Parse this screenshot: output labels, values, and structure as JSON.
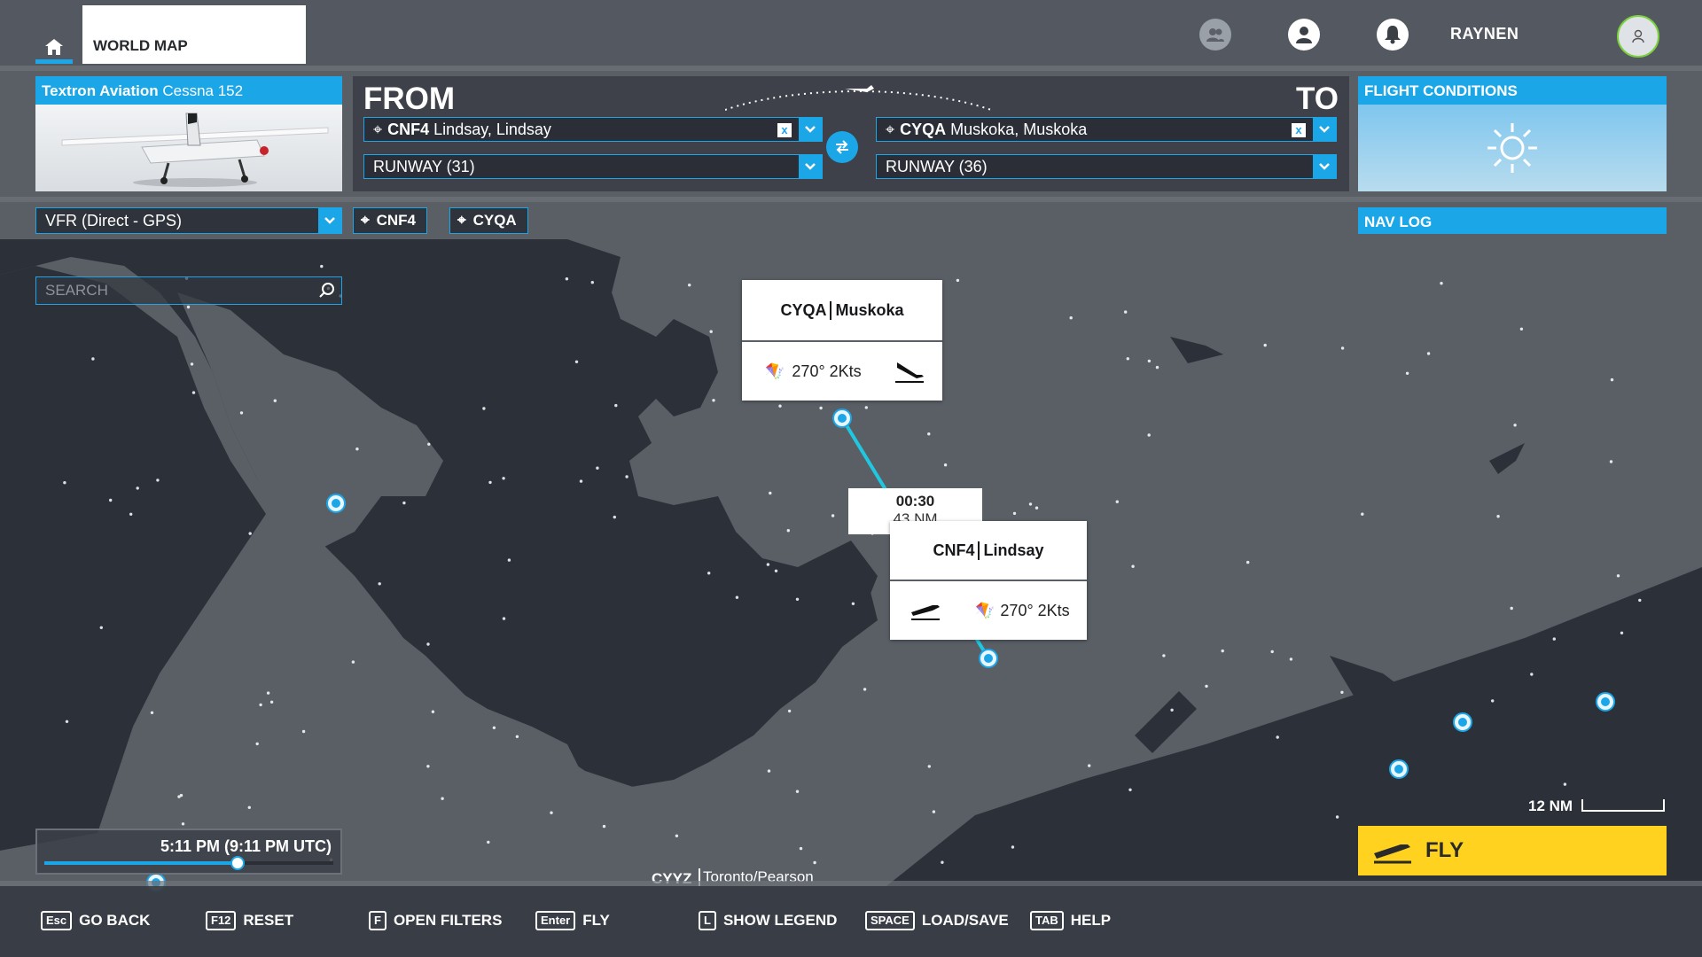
{
  "header": {
    "home_icon": "home-icon",
    "tab_label": "WORLD MAP",
    "icons": [
      "friends-icon",
      "profile-icon",
      "notifications-icon"
    ],
    "username": "RAYNEN",
    "avatar_icon": "user-avatar-icon"
  },
  "aircraft": {
    "brand": "Textron Aviation",
    "model": "Cessna 152"
  },
  "route": {
    "from_label": "FROM",
    "to_label": "TO",
    "departure": {
      "code": "CNF4",
      "name": "Lindsay, Lindsay",
      "runway": "RUNWAY (31)"
    },
    "arrival": {
      "code": "CYQA",
      "name": "Muskoka, Muskoka",
      "runway": "RUNWAY (36)"
    },
    "clear_glyph": "x"
  },
  "conditions": {
    "label": "FLIGHT CONDITIONS",
    "icon": "sun-icon"
  },
  "flight_type": {
    "value": "VFR (Direct - GPS)"
  },
  "waypoint_chips": [
    "CNF4",
    "CYQA"
  ],
  "nav_log": "NAV LOG",
  "search": {
    "placeholder": "SEARCH"
  },
  "map": {
    "arrival_card": {
      "code": "CYQA",
      "name": "Muskoka",
      "wind": "270° 2Kts"
    },
    "departure_card": {
      "code": "CNF4",
      "name": "Lindsay",
      "wind": "270° 2Kts"
    },
    "leg": {
      "time": "00:30",
      "distance": "43 NM"
    },
    "scale_label": "12 NM",
    "airport_code": "CYYZ",
    "airport_name": "Toronto/Pearson",
    "route_color": "#1fc8e0"
  },
  "time": {
    "label": "5:11 PM (9:11 PM UTC)",
    "progress_percent": 67
  },
  "fly_button": "FLY",
  "footer": [
    {
      "key": "Esc",
      "label": "GO BACK"
    },
    {
      "key": "F12",
      "label": "RESET"
    },
    {
      "key": "F",
      "label": "OPEN FILTERS"
    },
    {
      "key": "Enter",
      "label": "FLY"
    },
    {
      "key": "L",
      "label": "SHOW LEGEND"
    },
    {
      "key": "SPACE",
      "label": "LOAD/SAVE"
    },
    {
      "key": "TAB",
      "label": "HELP"
    }
  ],
  "colors": {
    "accent": "#1ba6e8",
    "fly": "#ffd21f",
    "land": "#5a5f66",
    "water": "#2c3039"
  }
}
